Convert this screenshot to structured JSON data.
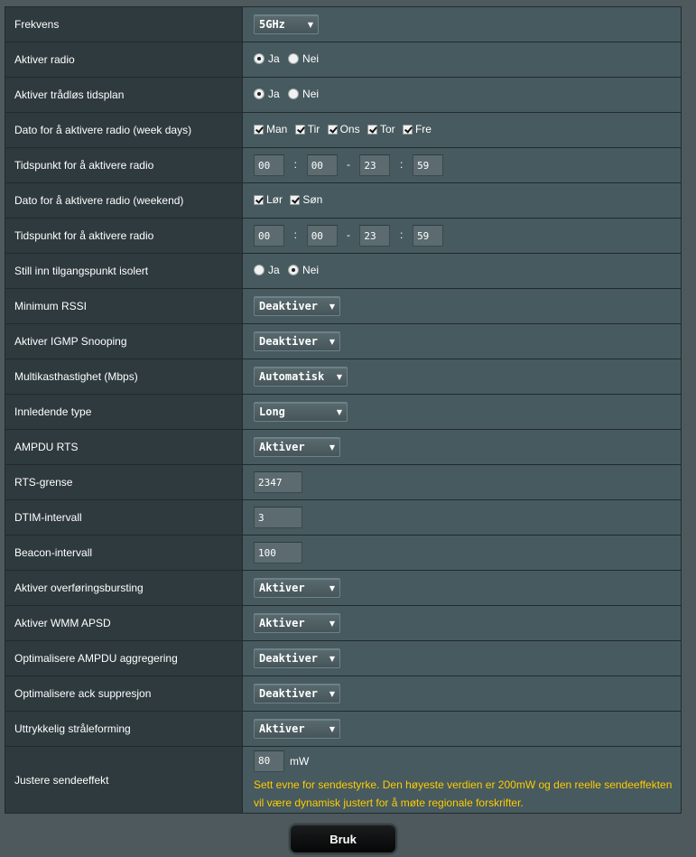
{
  "rows": {
    "frequency": {
      "label": "Frekvens",
      "value": "5GHz"
    },
    "enable_radio": {
      "label": "Aktiver radio",
      "options": [
        "Ja",
        "Nei"
      ],
      "selected": "Ja"
    },
    "wireless_schedule": {
      "label": "Aktiver trådløs tidsplan",
      "options": [
        "Ja",
        "Nei"
      ],
      "selected": "Ja"
    },
    "weekdays": {
      "label": "Dato for å aktivere radio (week days)",
      "days": [
        "Man",
        "Tir",
        "Ons",
        "Tor",
        "Fre"
      ]
    },
    "weekday_time": {
      "label": "Tidspunkt for å aktivere radio",
      "start_h": "00",
      "start_m": "00",
      "end_h": "23",
      "end_m": "59"
    },
    "weekend": {
      "label": "Dato for å aktivere radio (weekend)",
      "days": [
        "Lør",
        "Søn"
      ]
    },
    "weekend_time": {
      "label": "Tidspunkt for å aktivere radio",
      "start_h": "00",
      "start_m": "00",
      "end_h": "23",
      "end_m": "59"
    },
    "ap_isolated": {
      "label": "Still inn tilgangspunkt isolert",
      "options": [
        "Ja",
        "Nei"
      ],
      "selected": "Nei"
    },
    "min_rssi": {
      "label": "Minimum RSSI",
      "value": "Deaktiver"
    },
    "igmp_snooping": {
      "label": "Aktiver IGMP Snooping",
      "value": "Deaktiver"
    },
    "multicast_rate": {
      "label": "Multikasthastighet (Mbps)",
      "value": "Automatisk"
    },
    "preamble": {
      "label": "Innledende type",
      "value": "Long"
    },
    "ampdu_rts": {
      "label": "AMPDU RTS",
      "value": "Aktiver"
    },
    "rts_threshold": {
      "label": "RTS-grense",
      "value": "2347"
    },
    "dtim": {
      "label": "DTIM-intervall",
      "value": "3"
    },
    "beacon": {
      "label": "Beacon-intervall",
      "value": "100"
    },
    "tx_bursting": {
      "label": "Aktiver overføringsbursting",
      "value": "Aktiver"
    },
    "wmm_apsd": {
      "label": "Aktiver WMM APSD",
      "value": "Aktiver"
    },
    "ampdu_aggregation": {
      "label": "Optimalisere AMPDU aggregering",
      "value": "Deaktiver"
    },
    "ack_suppression": {
      "label": "Optimalisere ack suppresjon",
      "value": "Deaktiver"
    },
    "beamforming": {
      "label": "Uttrykkelig stråleforming",
      "value": "Aktiver"
    },
    "tx_power": {
      "label": "Justere sendeeffekt",
      "value": "80",
      "unit": "mW",
      "note": "Sett evne for sendestyrke. Den høyeste verdien er 200mW og den reelle sendeeffekten vil være dynamisk justert for å møte regionale forskrifter."
    }
  },
  "apply_label": "Bruk",
  "colors": {
    "label_bg": "#2f3a3e",
    "value_bg": "#475a5f",
    "note": "#ffcc00"
  }
}
